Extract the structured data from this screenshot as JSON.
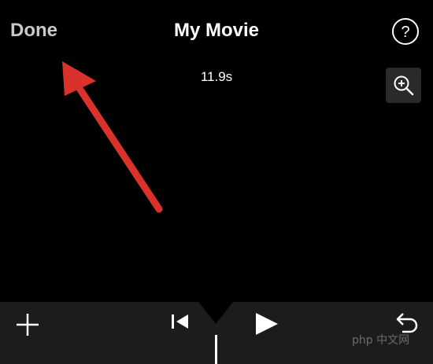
{
  "header": {
    "done_label": "Done",
    "title": "My Movie",
    "help_label": "?"
  },
  "timeline": {
    "duration": "11.9s"
  },
  "icons": {
    "help": "question-circle-icon",
    "zoom": "zoom-in-icon",
    "add": "plus-icon",
    "skip_back": "skip-to-start-icon",
    "play": "play-icon",
    "undo": "undo-icon"
  },
  "colors": {
    "background": "#000000",
    "toolbar": "#1c1c1e",
    "done_text": "#c9c9cb",
    "annotation_arrow": "#d9322b"
  },
  "watermark": "php 中文网"
}
